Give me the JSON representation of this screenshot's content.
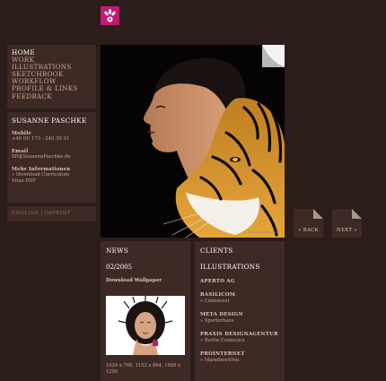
{
  "nav": {
    "items": [
      {
        "label": "HOME",
        "active": true
      },
      {
        "label": "WORK",
        "active": false
      },
      {
        "label": "ILLUSTRATIONS",
        "active": false
      },
      {
        "label": "SKETCHBOOK",
        "active": false
      },
      {
        "label": "WORKFLOW",
        "active": false
      },
      {
        "label": "PROFILE & LINKS",
        "active": false
      },
      {
        "label": "FEEDBACK",
        "active": false
      }
    ]
  },
  "profile": {
    "name": "SUSANNE PASCHKE",
    "mobile_label": "Mobile",
    "mobile_value": "+49 (0) 173 - 240 30 31",
    "email_label": "Email",
    "email_value": "SP@SusannePaschke.de",
    "more_label": "Mehr Informationen",
    "more_links": [
      "» Download Curriculum",
      "Vitae PDF"
    ]
  },
  "lang_bar": "ENGLISH | IMPRINT",
  "hero": {
    "credit": "Susanne Paschke"
  },
  "buttons": {
    "back": "« BACK",
    "next": "NEXT »"
  },
  "news": {
    "title": "NEWS",
    "date": "02/2005",
    "subtitle": "Download Wallpaper",
    "resolutions": "1024 x 768, 1152 x 864, 1600 x 1200"
  },
  "clients": {
    "title": "CLIENTS",
    "subtitle": "ILLUSTRATIONS",
    "list": [
      {
        "name": "APERTO AG",
        "project": ""
      },
      {
        "name": "BASILICOM",
        "project": "» Cominvest"
      },
      {
        "name": "META DESIGN",
        "project": "» Sportorhaus"
      },
      {
        "name": "PRAXIS DESIGNAGENTUR",
        "project": "» Berlin Cosmetics"
      },
      {
        "name": "PROINTERNET",
        "project": "» Marathon4You"
      }
    ]
  },
  "colors": {
    "background": "#2a1d1a",
    "panel": "#3e2a24",
    "logo": "#c01a72",
    "hero_bg": "#050303"
  }
}
